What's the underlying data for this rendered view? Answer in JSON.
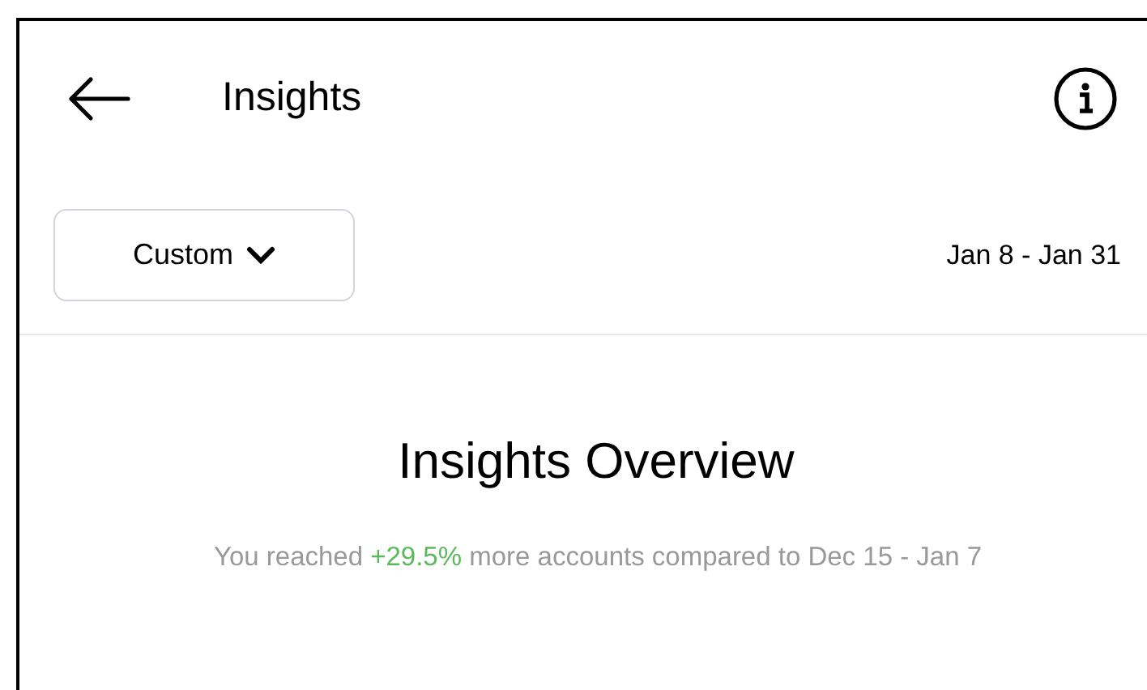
{
  "header": {
    "title": "Insights"
  },
  "filter": {
    "label": "Custom",
    "date_range": "Jan 8 - Jan 31"
  },
  "overview": {
    "title": "Insights Overview",
    "summary": {
      "before": "You reached ",
      "highlight": "+29.5%",
      "after": " more accounts compared to Dec 15 - Jan 7"
    }
  }
}
